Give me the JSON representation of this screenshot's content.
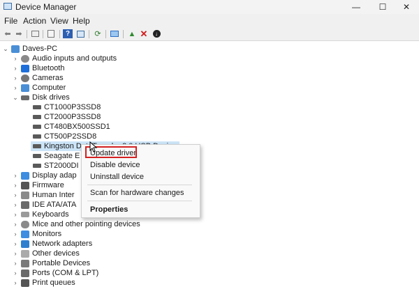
{
  "window": {
    "title": "Device Manager",
    "minimize": "—",
    "maximize": "☐",
    "close": "✕"
  },
  "menu": {
    "file": "File",
    "action": "Action",
    "view": "View",
    "help": "Help"
  },
  "tree": {
    "root": "Daves-PC",
    "categories": {
      "audio": "Audio inputs and outputs",
      "bluetooth": "Bluetooth",
      "cameras": "Cameras",
      "computer": "Computer",
      "disk_drives": "Disk drives",
      "display": "Display adap",
      "firmware": "Firmware",
      "hid": "Human Inter",
      "ide": "IDE ATA/ATA",
      "keyboards": "Keyboards",
      "mice": "Mice and other pointing devices",
      "monitors": "Monitors",
      "network": "Network adapters",
      "other": "Other devices",
      "portable": "Portable Devices",
      "ports": "Ports (COM & LPT)",
      "print": "Print queues"
    },
    "disks": [
      "CT1000P3SSD8",
      "CT2000P3SSD8",
      "CT480BX500SSD1",
      "CT500P2SSD8",
      "Kingston DataTraveler 3.0 USB Device",
      "Seagate E",
      "ST2000DI"
    ]
  },
  "context_menu": {
    "update": "Update driver",
    "disable": "Disable device",
    "uninstall": "Uninstall device",
    "scan": "Scan for hardware changes",
    "properties": "Properties"
  },
  "colors": {
    "highlight_border": "#d42020",
    "selection": "#cce4f7"
  }
}
